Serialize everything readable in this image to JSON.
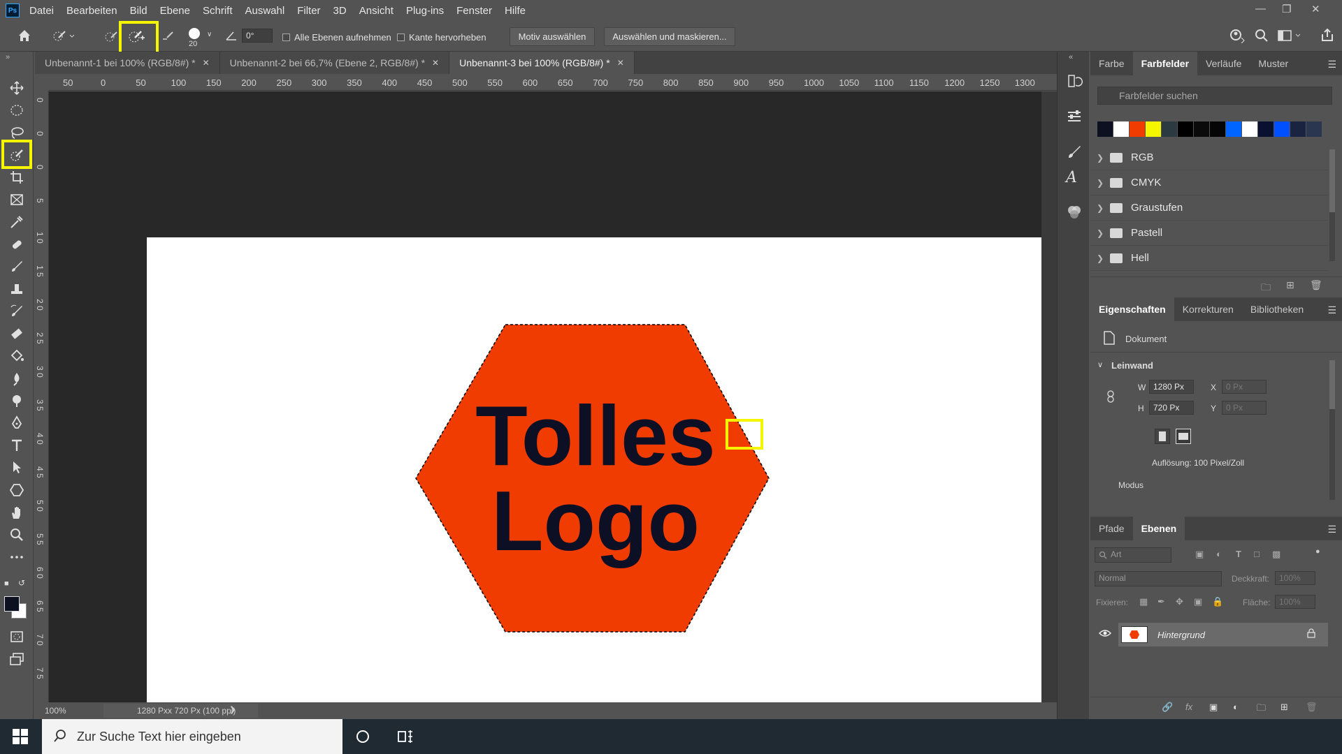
{
  "app": {
    "logo": "Ps"
  },
  "menu": [
    "Datei",
    "Bearbeiten",
    "Bild",
    "Ebene",
    "Schrift",
    "Auswahl",
    "Filter",
    "3D",
    "Ansicht",
    "Plug-ins",
    "Fenster",
    "Hilfe"
  ],
  "options": {
    "brush_size": "20",
    "angle": "0°",
    "sample_all_layers": "Alle Ebenen aufnehmen",
    "enhance_edge": "Kante hervorheben",
    "select_subject": "Motiv auswählen",
    "select_and_mask": "Auswählen und maskieren..."
  },
  "tabs": [
    {
      "label": "Unbenannt-1 bei 100% (RGB/8#) *",
      "active": false
    },
    {
      "label": "Unbenannt-2 bei 66,7% (Ebene 2, RGB/8#) *",
      "active": false
    },
    {
      "label": "Unbenannt-3 bei 100% (RGB/8#) *",
      "active": true
    }
  ],
  "ruler": {
    "top_ticks": [
      "50",
      "0",
      "50",
      "100",
      "150",
      "200",
      "250",
      "300",
      "350",
      "400",
      "450",
      "500",
      "550",
      "600",
      "650",
      "700",
      "750",
      "800",
      "850",
      "900",
      "950",
      "1000",
      "1050",
      "1100",
      "1150",
      "1200",
      "1250",
      "1300"
    ],
    "left_ticks": [
      "0",
      "0",
      "0",
      "5",
      "1 0",
      "1 5",
      "2 0",
      "2 5",
      "3 0",
      "3 5",
      "4 0",
      "4 5",
      "5 0",
      "5 5",
      "6 0",
      "6 5",
      "7 0",
      "7 5"
    ]
  },
  "canvas": {
    "logo_text_line1": "Tolles",
    "logo_text_line2": "Logo",
    "logo_color": "#f03c00",
    "text_color": "#0d0f24"
  },
  "status": {
    "zoom": "100%",
    "info": "1280 Pxx 720 Px (100 ppi)"
  },
  "swatches_panel": {
    "tabs": [
      "Farbe",
      "Farbfelder",
      "Verläufe",
      "Muster"
    ],
    "active_tab": "Farbfelder",
    "search_placeholder": "Farbfelder suchen",
    "colors": [
      "#0d1020",
      "#ffffff",
      "#f03c00",
      "#f5f500",
      "#2b3940",
      "#000000",
      "#0a0a0a",
      "#050505",
      "#0064ff",
      "#ffffff",
      "#0a1030",
      "#0050ff",
      "#1a2440",
      "#2a3550"
    ],
    "folders": [
      "RGB",
      "CMYK",
      "Graustufen",
      "Pastell",
      "Hell"
    ]
  },
  "properties_panel": {
    "tabs": [
      "Eigenschaften",
      "Korrekturen",
      "Bibliotheken"
    ],
    "doc_label": "Dokument",
    "section": "Leinwand",
    "w_label": "W",
    "w_value": "1280 Px",
    "h_label": "H",
    "h_value": "720 Px",
    "x_label": "X",
    "x_value": "0 Px",
    "y_label": "Y",
    "y_value": "0 Px",
    "resolution": "Auflösung: 100 Pixel/Zoll",
    "mode_label": "Modus"
  },
  "layers_panel": {
    "tabs": [
      "Pfade",
      "Ebenen"
    ],
    "filter_placeholder": "Art",
    "blend_mode": "Normal",
    "opacity_label": "Deckkraft:",
    "opacity_value": "100%",
    "lock_label": "Fixieren:",
    "fill_label": "Fläche:",
    "fill_value": "100%",
    "layer_name": "Hintergrund"
  },
  "taskbar": {
    "search_placeholder": "Zur Suche Text hier eingeben"
  },
  "colors": {
    "highlight": "#f5f500",
    "accent": "#31a8ff"
  }
}
